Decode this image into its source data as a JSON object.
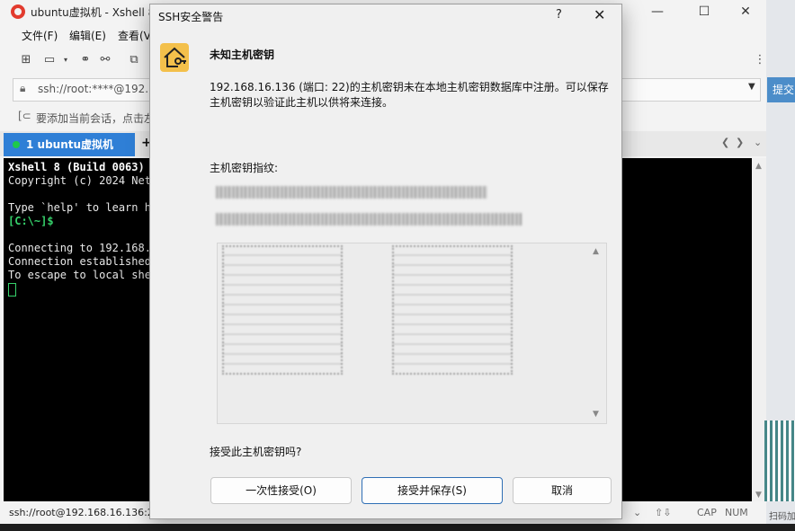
{
  "window": {
    "title": "ubuntu虚拟机 - Xshell 8 ("
  },
  "menu": [
    "文件(F)",
    "编辑(E)",
    "查看(V"
  ],
  "address": {
    "value": "ssh://root:****@192.1",
    "connect_label": "提交"
  },
  "hint_text": "要添加当前会话，点击左",
  "tab": {
    "label": "1 ubuntu虚拟机",
    "add": "+"
  },
  "terminal": {
    "line1": "Xshell 8 (Build 0063)",
    "line2": "Copyright (c) 2024 Net",
    "line3": "Type `help' to learn ho",
    "prompt": "[C:\\~]$",
    "line5": "Connecting to 192.168.1",
    "line6": "Connection established",
    "line7": "To escape to local she"
  },
  "status": {
    "session": "ssh://root@192.168.16.136:22",
    "cap": "CAP",
    "num": "NUM"
  },
  "right_hint": "扫码加",
  "dialog": {
    "title": "SSH安全警告",
    "help": "?",
    "heading": "未知主机密钥",
    "message": "192.168.16.136 (端口: 22)的主机密钥未在本地主机密钥数据库中注册。可以保存主机密钥以验证此主机以供将来连接。",
    "fingerprint_label": "主机密钥指纹:",
    "question": "接受此主机密钥吗?",
    "buttons": {
      "once": "一次性接受(O)",
      "save": "接受并保存(S)",
      "cancel": "取消"
    }
  }
}
